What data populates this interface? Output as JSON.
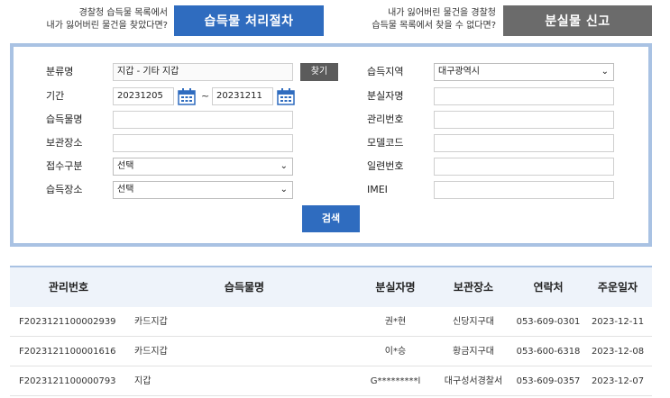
{
  "banner": {
    "left_line1": "경찰청 습득물 목록에서",
    "left_line2": "내가 잃어버린 물건을 찾았다면?",
    "procedure_button": "습득물 처리절차",
    "right_line1": "내가 잃어버린 물건을 경찰청",
    "right_line2": "습득물 목록에서 찾을 수 없다면?",
    "report_button": "분실물 신고"
  },
  "search": {
    "category_label": "분류명",
    "category_value": "지갑 - 기타 지갑",
    "find_button": "찾기",
    "period_label": "기간",
    "date_from": "20231205",
    "date_sep": "~",
    "date_to": "20231211",
    "item_name_label": "습득물명",
    "storage_label": "보관장소",
    "receipt_type_label": "접수구분",
    "receipt_type_value": "선택",
    "found_place_label": "습득장소",
    "found_place_value": "선택",
    "region_label": "습득지역",
    "region_value": "대구광역시",
    "loser_name_label": "분실자명",
    "manage_no_label": "관리번호",
    "model_code_label": "모델코드",
    "serial_no_label": "일련번호",
    "imei_label": "IMEI",
    "search_button": "검색"
  },
  "results": {
    "headers": [
      "관리번호",
      "습득물명",
      "분실자명",
      "보관장소",
      "연락처",
      "주운일자"
    ],
    "rows": [
      [
        "F2023121100002939",
        "카드지갑",
        "권*현",
        "신당지구대",
        "053-609-0301",
        "2023-12-11"
      ],
      [
        "F2023121100001616",
        "카드지갑",
        "이*승",
        "황금지구대",
        "053-600-6318",
        "2023-12-08"
      ],
      [
        "F2023121100000793",
        "지갑",
        "G*********l",
        "대구성서경찰서",
        "053-609-0357",
        "2023-12-07"
      ]
    ]
  }
}
